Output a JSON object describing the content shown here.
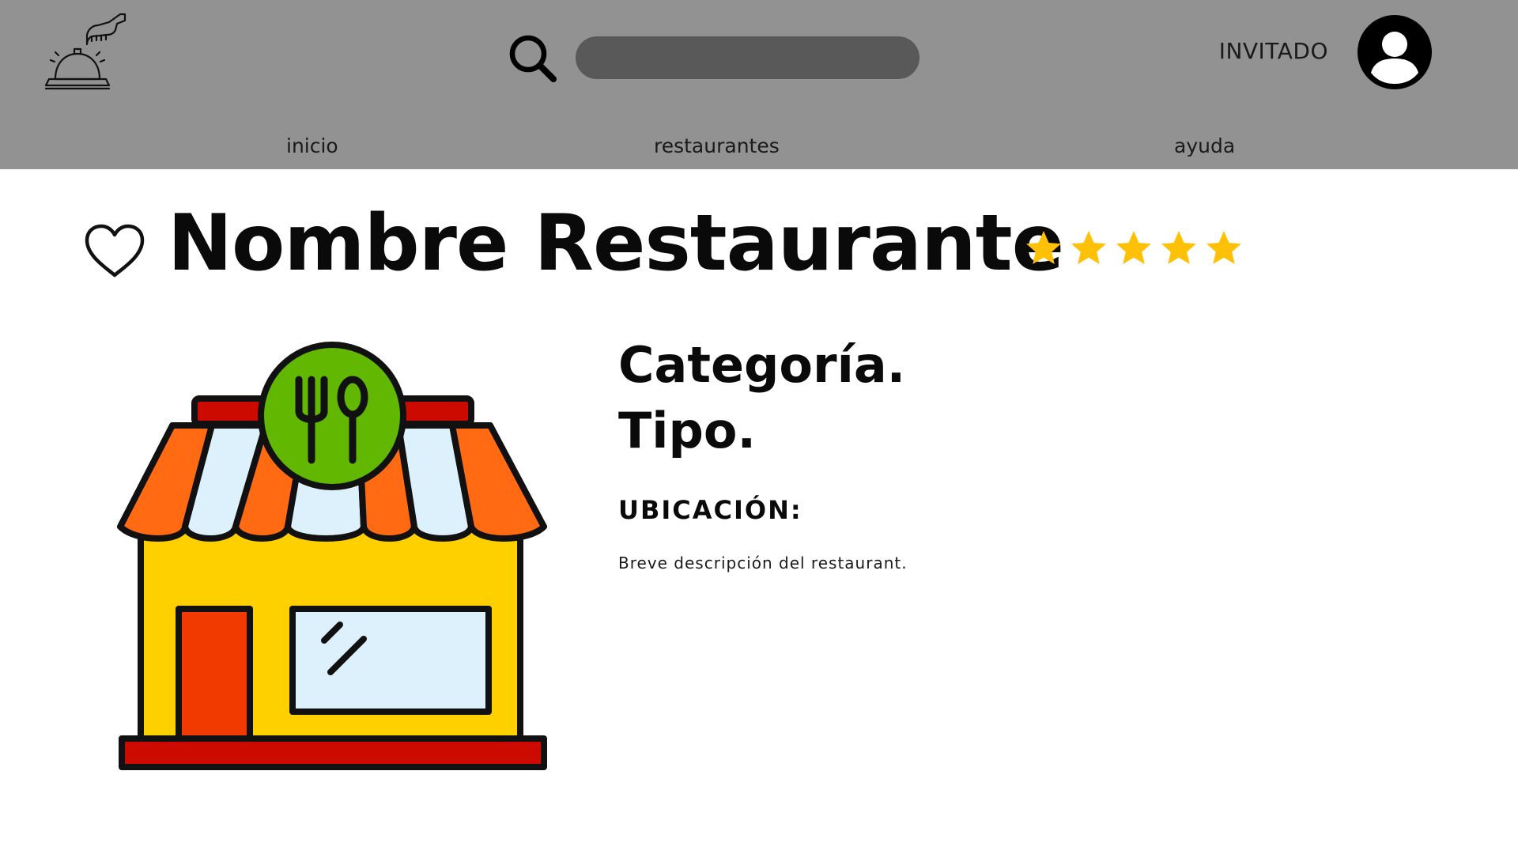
{
  "header": {
    "background": "#929292",
    "logo_icon": "service-bell-icon",
    "search": {
      "icon": "search-icon",
      "value": "",
      "placeholder": ""
    },
    "user_label": "INVITADO",
    "avatar_icon": "user-avatar-icon"
  },
  "nav": {
    "items": [
      {
        "label": "inicio"
      },
      {
        "label": "restaurantes"
      },
      {
        "label": "ayuda"
      }
    ]
  },
  "restaurant": {
    "favorite_icon": "heart-outline-icon",
    "name": "Nombre Restaurante",
    "rating": 5,
    "rating_max": 5,
    "star_color": "#FFC107",
    "image_icon": "restaurant-storefront-icon",
    "category": "Categoría.",
    "type": "Tipo.",
    "location_label": "UBICACIÓN:",
    "description": "Breve descripción del restaurant."
  }
}
